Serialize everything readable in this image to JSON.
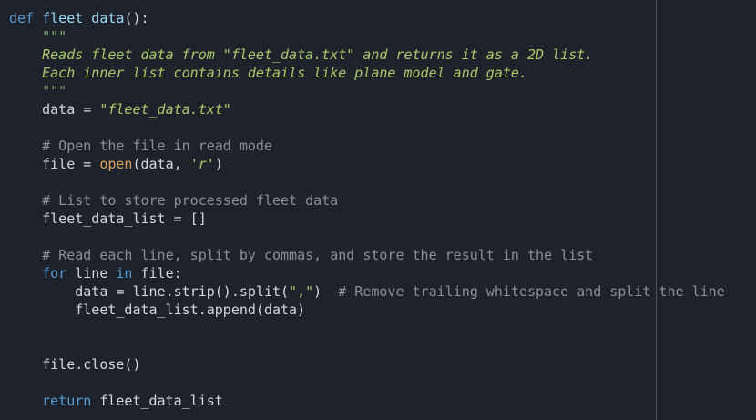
{
  "editor": {
    "ruler_color": "#4a5058",
    "background": "#1e232b",
    "lines": [
      [
        {
          "t": "def ",
          "c": "keyword"
        },
        {
          "t": "fleet_data",
          "c": "func"
        },
        {
          "t": "():",
          "c": "plain"
        }
      ],
      [
        {
          "t": "    ",
          "c": "plain"
        },
        {
          "t": "\"\"\"",
          "c": "docq"
        }
      ],
      [
        {
          "t": "    ",
          "c": "plain"
        },
        {
          "t": "Reads fleet data from \"fleet_data.txt\" and returns it as a 2D list.",
          "c": "doc"
        }
      ],
      [
        {
          "t": "    ",
          "c": "plain"
        },
        {
          "t": "Each inner list contains details like plane model and gate.",
          "c": "doc"
        }
      ],
      [
        {
          "t": "    ",
          "c": "plain"
        },
        {
          "t": "\"\"\"",
          "c": "docq"
        }
      ],
      [
        {
          "t": "    data = ",
          "c": "plain"
        },
        {
          "t": "\"fleet_data.txt\"",
          "c": "itstr"
        }
      ],
      [],
      [
        {
          "t": "    ",
          "c": "plain"
        },
        {
          "t": "# Open the file in read mode",
          "c": "comment"
        }
      ],
      [
        {
          "t": "    file = ",
          "c": "plain"
        },
        {
          "t": "open",
          "c": "builtin"
        },
        {
          "t": "(data, ",
          "c": "plain"
        },
        {
          "t": "'r'",
          "c": "itstr"
        },
        {
          "t": ")",
          "c": "plain"
        }
      ],
      [],
      [
        {
          "t": "    ",
          "c": "plain"
        },
        {
          "t": "# List to store processed fleet data",
          "c": "comment"
        }
      ],
      [
        {
          "t": "    fleet_data_list = []",
          "c": "plain"
        }
      ],
      [],
      [
        {
          "t": "    ",
          "c": "plain"
        },
        {
          "t": "# Read each line, split by commas, and store the result in the list",
          "c": "comment"
        }
      ],
      [
        {
          "t": "    ",
          "c": "plain"
        },
        {
          "t": "for",
          "c": "keyword"
        },
        {
          "t": " line ",
          "c": "plain"
        },
        {
          "t": "in",
          "c": "keyword"
        },
        {
          "t": " file:",
          "c": "plain"
        }
      ],
      [
        {
          "t": "        data = line.strip().split(",
          "c": "plain"
        },
        {
          "t": "\",\"",
          "c": "string"
        },
        {
          "t": ")  ",
          "c": "plain"
        },
        {
          "t": "# Remove trailing whitespace and split the line",
          "c": "comment"
        }
      ],
      [
        {
          "t": "        fleet_data_list.append(data)",
          "c": "plain"
        }
      ],
      [],
      [],
      [
        {
          "t": "    file.close()",
          "c": "plain"
        }
      ],
      [],
      [
        {
          "t": "    ",
          "c": "plain"
        },
        {
          "t": "return",
          "c": "keyword"
        },
        {
          "t": " fleet_data_list",
          "c": "plain"
        }
      ]
    ]
  }
}
